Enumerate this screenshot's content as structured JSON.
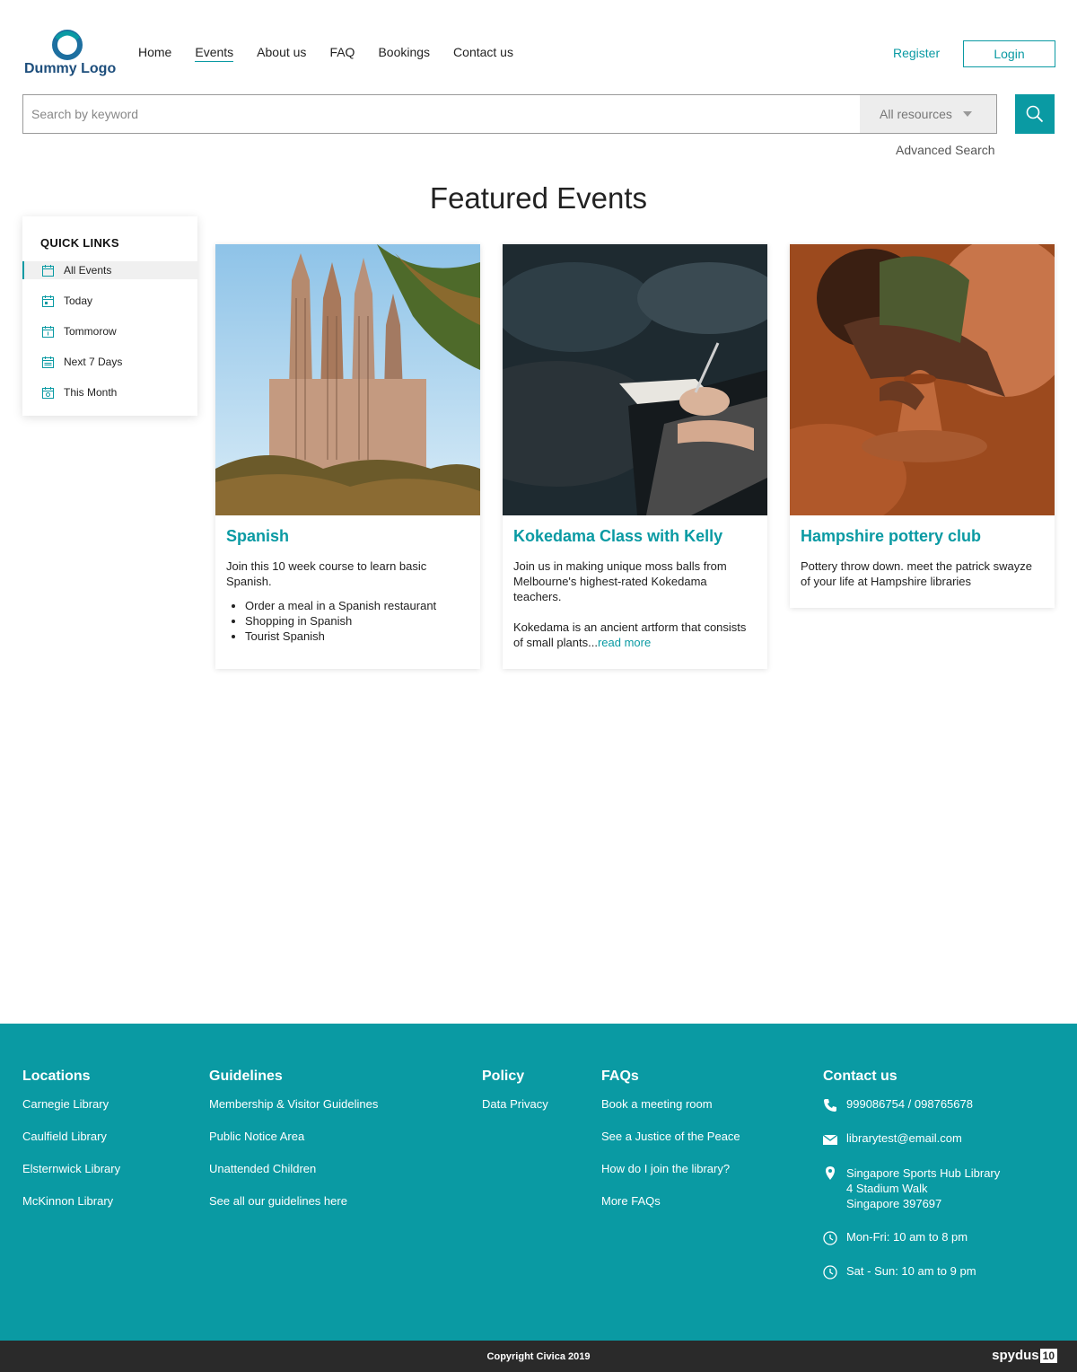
{
  "header": {
    "logo_text": "Dummy Logo",
    "nav": [
      "Home",
      "Events",
      "About us",
      "FAQ",
      "Bookings",
      "Contact us"
    ],
    "active_nav": "Events",
    "register_label": "Register",
    "login_label": "Login"
  },
  "search": {
    "placeholder": "Search by keyword",
    "value": "",
    "resource_selected": "All resources",
    "advanced_label": "Advanced Search"
  },
  "page": {
    "title": "Featured Events"
  },
  "quick_links": {
    "title": "QUICK LINKS",
    "items": [
      {
        "label": "All Events",
        "active": true
      },
      {
        "label": "Today"
      },
      {
        "label": "Tommorow"
      },
      {
        "label": "Next 7 Days"
      },
      {
        "label": "This Month"
      }
    ]
  },
  "events": [
    {
      "title": "Spanish",
      "description": "Join this 10 week course to learn basic Spanish.",
      "bullets": [
        "Order a meal in a Spanish restaurant",
        "Shopping in Spanish",
        "Tourist Spanish"
      ]
    },
    {
      "title": "Kokedama Class with Kelly",
      "description": "Join us in making unique moss balls from Melbourne's highest-rated Kokedama teachers.",
      "description2": "Kokedama is an ancient artform that consists of small plants...",
      "read_more": "read more"
    },
    {
      "title": "Hampshire pottery club",
      "description": "Pottery throw down. meet the patrick swayze of your life at Hampshire libraries"
    }
  ],
  "footer": {
    "locations": {
      "title": "Locations",
      "links": [
        "Carnegie Library",
        "Caulfield Library",
        "Elsternwick Library",
        "McKinnon Library"
      ]
    },
    "guidelines": {
      "title": "Guidelines",
      "links": [
        "Membership & Visitor Guidelines",
        "Public Notice Area",
        "Unattended Children",
        "See all our guidelines here"
      ]
    },
    "policy": {
      "title": "Policy",
      "links": [
        "Data Privacy"
      ]
    },
    "faqs": {
      "title": "FAQs",
      "links": [
        "Book a meeting room",
        "See a Justice of the Peace",
        "How do I join the library?",
        "More FAQs"
      ]
    },
    "contact": {
      "title": "Contact us",
      "phone": "999086754 / 098765678",
      "email": "librarytest@email.com",
      "address": [
        "Singapore Sports Hub Library",
        "4 Stadium Walk",
        "Singapore 397697"
      ],
      "hours_weekday": "Mon-Fri: 10 am to 8 pm",
      "hours_weekend": "Sat - Sun: 10 am to 9 pm"
    },
    "copyright": "Copyright Civica 2019",
    "brand": "spydus",
    "brand_version": "10"
  },
  "colors": {
    "accent": "#0a9aa3",
    "logo": "#1d4e7c",
    "bottom_bar": "#2a2a2a"
  }
}
